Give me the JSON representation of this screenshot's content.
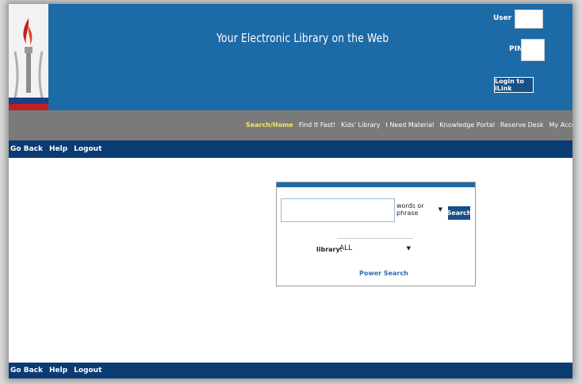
{
  "header": {
    "site_title": "Your Electronic Library on the Web",
    "user_id_label": "User ID:",
    "pin_label": "PIN:",
    "login_button": "Login to iLink"
  },
  "nav": {
    "items": [
      {
        "label": "Search/Home",
        "active": true
      },
      {
        "label": "Find It Fast!",
        "active": false
      },
      {
        "label": "Kids' Library",
        "active": false
      },
      {
        "label": "I Need Material",
        "active": false
      },
      {
        "label": "Knowledge Portal",
        "active": false
      },
      {
        "label": "Reserve Desk",
        "active": false
      },
      {
        "label": "My Account",
        "active": false
      }
    ]
  },
  "linkbar": {
    "go_back": "Go Back",
    "help": "Help",
    "logout": "Logout"
  },
  "search": {
    "type_value": "words or phrase",
    "search_button": "Search",
    "library_label": "library:",
    "library_value": "ALL",
    "power_search": "Power Search"
  },
  "colors": {
    "header_blue": "#1c6aa6",
    "nav_gray": "#7a7a7a",
    "linkbar_navy": "#0b3b73",
    "active_nav": "#f5e46b"
  }
}
